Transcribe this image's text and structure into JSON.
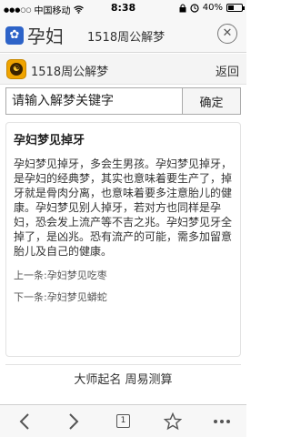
{
  "status_bar": {
    "carrier": "中国移动",
    "time": "8:38",
    "battery_text": "40%",
    "battery_level": 0.4
  },
  "browser": {
    "left_tab_title": "孕妇",
    "page_title": "1518周公解梦",
    "close_label": "✕"
  },
  "site": {
    "name": "1518周公解梦",
    "back_label": "返回",
    "logo_glyph": "☯"
  },
  "search": {
    "placeholder": "请输入解梦关键字",
    "button_label": "确定"
  },
  "article": {
    "title": "孕妇梦见掉牙",
    "body": "孕妇梦见掉牙，多会生男孩。孕妇梦见掉牙，是孕妇的经典梦，其实也意味着要生产了，掉牙就是骨肉分离，也意味着要多注意胎儿的健康。孕妇梦见别人掉牙，若对方也同样是孕妇，恐会发上流产等不吉之兆。孕妇梦见牙全掉了，是凶兆。恐有流产的可能，需多加留意胎儿及自己的健康。",
    "prev_label": "上一条:",
    "prev_link": "孕妇梦见吃枣",
    "next_label": "下一条:",
    "next_link": "孕妇梦见蟒蛇"
  },
  "promo": {
    "text": "大师起名 周易测算"
  },
  "toolbar": {
    "tab_count": "1"
  },
  "icons": [
    "signal-dots-icon",
    "wifi-icon",
    "lock-icon",
    "alarm-icon",
    "battery-icon",
    "paw-icon",
    "close-icon",
    "back-arrow-icon",
    "forward-arrow-icon",
    "tabs-icon",
    "star-icon",
    "more-icon"
  ]
}
